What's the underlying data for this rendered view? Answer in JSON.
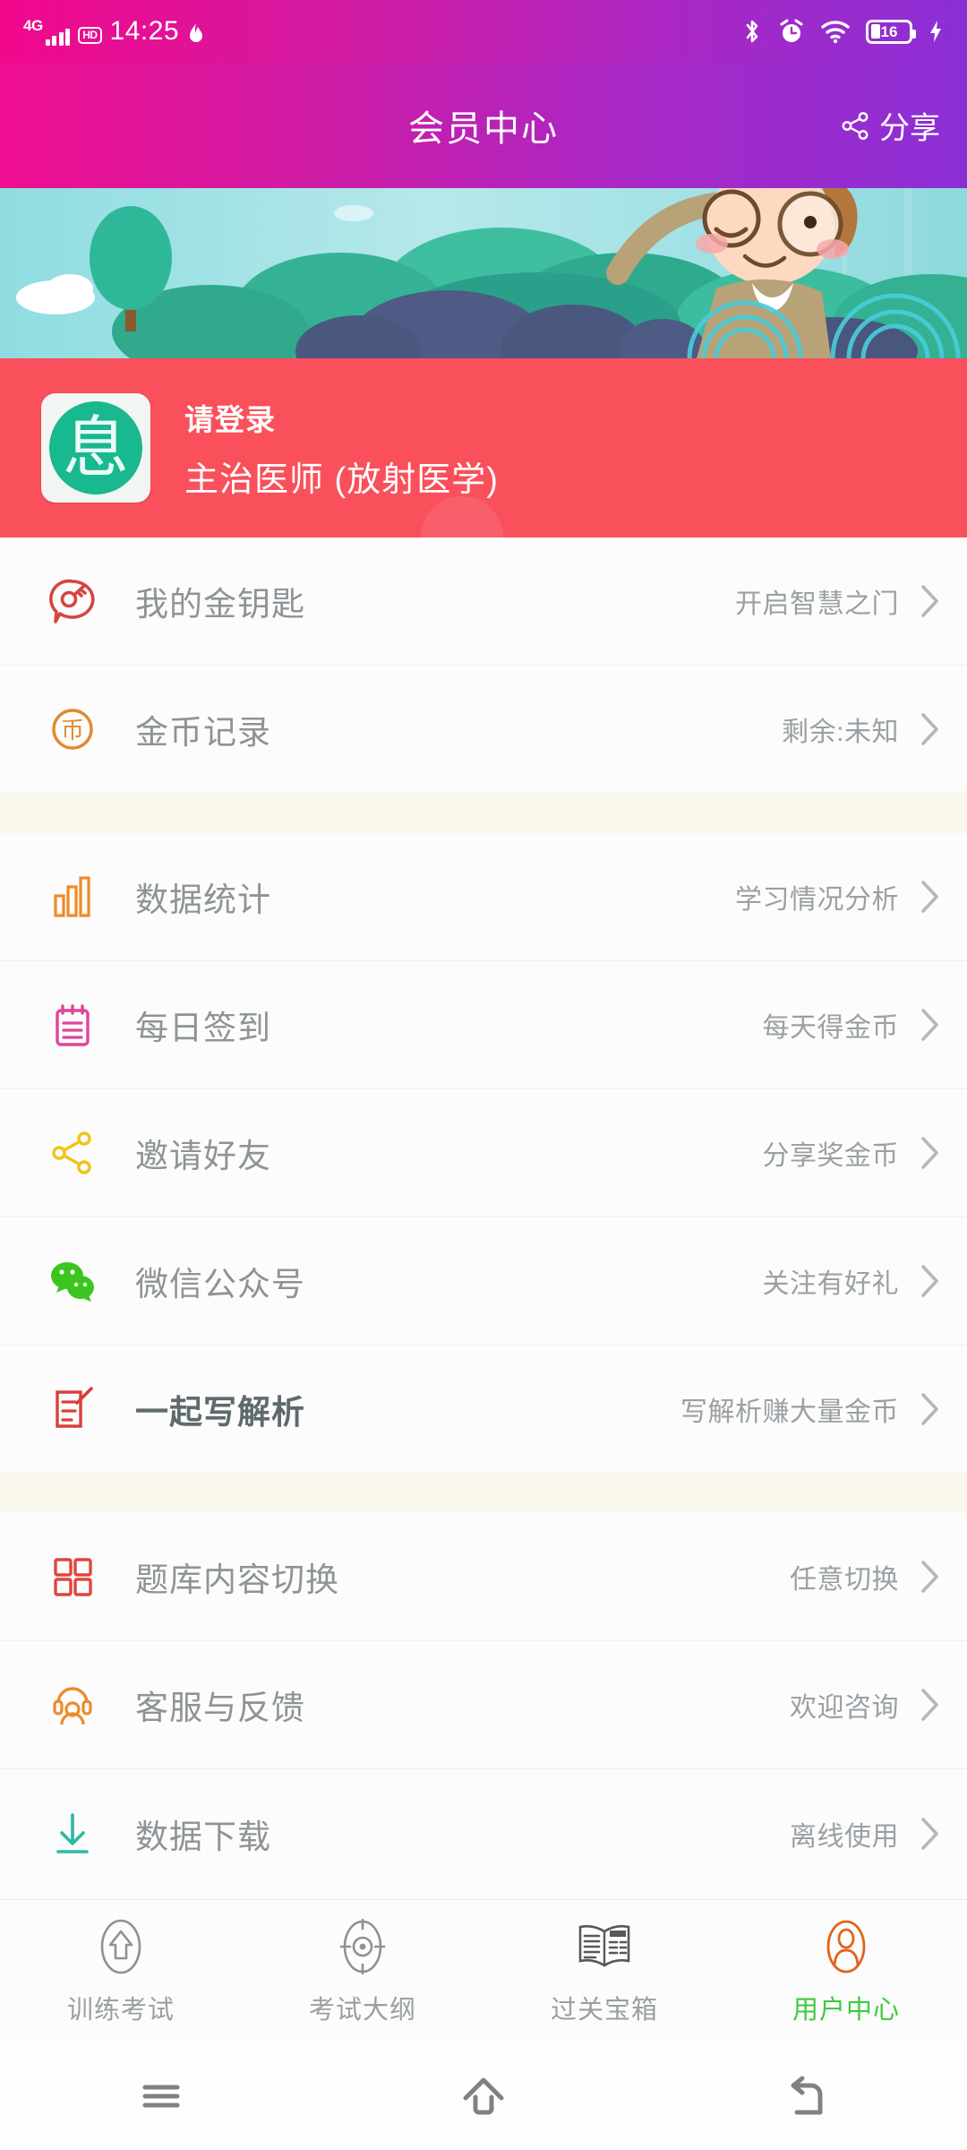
{
  "status_bar": {
    "network": "4G",
    "hd_badge": "HD",
    "time": "14:25",
    "battery_percent": "16",
    "battery_level": 16,
    "icons": [
      "signal-icon",
      "hd-icon",
      "flame-icon",
      "bluetooth-icon",
      "alarm-icon",
      "wifi-icon",
      "battery-icon",
      "charging-bolt-icon"
    ]
  },
  "header": {
    "title": "会员中心",
    "share_label": "分享"
  },
  "profile": {
    "avatar_glyph": "息",
    "login_prompt": "请登录",
    "role": "主治医师 (放射医学)"
  },
  "menu_groups": [
    {
      "items": [
        {
          "icon": "key-bubble-icon",
          "icon_color": "#d4453f",
          "label": "我的金钥匙",
          "hint": "开启智慧之门",
          "emphasis": false
        },
        {
          "icon": "coin-icon",
          "icon_color": "#e08a2e",
          "label": "金币记录",
          "hint": "剩余:未知",
          "emphasis": false
        }
      ]
    },
    {
      "items": [
        {
          "icon": "bar-chart-icon",
          "icon_color": "#ef8b24",
          "label": "数据统计",
          "hint": "学习情况分析",
          "emphasis": false
        },
        {
          "icon": "calendar-checkin-icon",
          "icon_color": "#e0459a",
          "label": "每日签到",
          "hint": "每天得金币",
          "emphasis": false
        },
        {
          "icon": "share-nodes-icon",
          "icon_color": "#f0c419",
          "label": "邀请好友",
          "hint": "分享奖金币",
          "emphasis": false
        },
        {
          "icon": "wechat-icon",
          "icon_color": "#3cc51f",
          "label": "微信公众号",
          "hint": "关注有好礼",
          "emphasis": false
        },
        {
          "icon": "edit-note-icon",
          "icon_color": "#d8403a",
          "label": "一起写解析",
          "hint": "写解析赚大量金币",
          "emphasis": true
        }
      ]
    },
    {
      "items": [
        {
          "icon": "grid-squares-icon",
          "icon_color": "#e0443e",
          "label": "题库内容切换",
          "hint": "任意切换",
          "emphasis": false
        },
        {
          "icon": "customer-service-icon",
          "icon_color": "#ee8b2c",
          "label": "客服与反馈",
          "hint": "欢迎咨询",
          "emphasis": false
        },
        {
          "icon": "download-icon",
          "icon_color": "#2bb9a4",
          "label": "数据下载",
          "hint": "离线使用",
          "emphasis": false
        }
      ]
    }
  ],
  "tab_bar": {
    "active_color": "#3ec93e",
    "active_icon_color": "#e2631a",
    "tabs": [
      {
        "icon": "home-exam-icon",
        "label": "训练考试",
        "active": false
      },
      {
        "icon": "target-outline-icon",
        "label": "考试大纲",
        "active": false
      },
      {
        "icon": "news-book-icon",
        "label": "过关宝箱",
        "active": false
      },
      {
        "icon": "user-person-icon",
        "label": "用户中心",
        "active": true
      }
    ]
  },
  "android_nav": {
    "buttons": [
      {
        "icon": "menu-icon",
        "name": "recents"
      },
      {
        "icon": "home-icon",
        "name": "home"
      },
      {
        "icon": "back-icon",
        "name": "back"
      }
    ]
  },
  "colors": {
    "header_gradient_start": "#ef0e90",
    "header_gradient_end": "#8c2fd6",
    "profile_red": "#f9505c",
    "group_gap": "#faf7ec",
    "list_bg": "#fcfcfc"
  }
}
